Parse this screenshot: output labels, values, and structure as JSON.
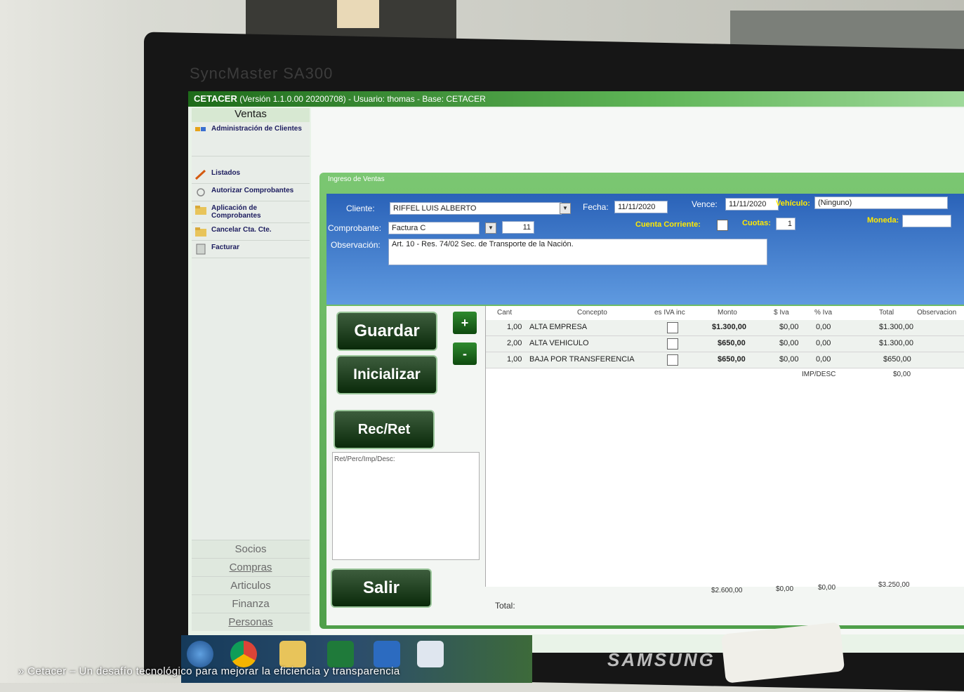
{
  "monitor": {
    "model": "SyncMaster SA300",
    "brand": "SAMSUNG"
  },
  "app": {
    "title_bold": "CETACER",
    "title_rest": "(Versión 1.1.0.00 20200708) - Usuario: thomas - Base: CETACER"
  },
  "sidebar": {
    "header": "Ventas",
    "items": [
      {
        "label": "Administración de Clientes",
        "icon": "clients-icon"
      },
      {
        "label": "Listados",
        "icon": "pencil-icon"
      },
      {
        "label": "Autorizar Comprobantes",
        "icon": "authorize-icon"
      },
      {
        "label": "Aplicación de Comprobantes",
        "icon": "folder-icon"
      },
      {
        "label": "Cancelar Cta. Cte.",
        "icon": "folder-icon"
      },
      {
        "label": "Facturar",
        "icon": "invoice-icon"
      }
    ],
    "bottom": [
      "Socios",
      "Compras",
      "Articulos",
      "Finanza",
      "Personas"
    ]
  },
  "window": {
    "title": "Ingreso de Ventas"
  },
  "form": {
    "cliente_label": "Cliente:",
    "cliente_value": "RIFFEL LUIS ALBERTO",
    "fecha_label": "Fecha:",
    "fecha_value": "11/11/2020",
    "vence_label": "Vence:",
    "vence_value": "11/11/2020",
    "vehiculo_label": "Vehículo:",
    "vehiculo_value": "(Ninguno)",
    "comprobante_label": "Comprobante:",
    "comprobante_value": "Factura C",
    "comprobante_num": "11",
    "cta_cte_label": "Cuenta Corriente:",
    "cuotas_label": "Cuotas:",
    "cuotas_value": "1",
    "moneda_label": "Moneda:",
    "obs_label": "Observación:",
    "obs_value": "Art. 10 - Res. 74/02 Sec. de Transporte de la Nación."
  },
  "buttons": {
    "guardar": "Guardar",
    "inicializar": "Inicializar",
    "recret": "Rec/Ret",
    "salir": "Salir",
    "add": "+",
    "remove": "-"
  },
  "ret_label": "Ret/Perc/Imp/Desc:",
  "table": {
    "headers": [
      "Cant",
      "Concepto",
      "es IVA inc",
      "Monto",
      "$ Iva",
      "% Iva",
      "Total",
      "Observacion"
    ],
    "rows": [
      {
        "cant": "1,00",
        "concepto": "ALTA EMPRESA",
        "monto": "$1.300,00",
        "iva": "$0,00",
        "piva": "0,00",
        "total": "$1.300,00"
      },
      {
        "cant": "2,00",
        "concepto": "ALTA VEHICULO",
        "monto": "$650,00",
        "iva": "$0,00",
        "piva": "0,00",
        "total": "$1.300,00"
      },
      {
        "cant": "1,00",
        "concepto": "BAJA POR TRANSFERENCIA",
        "monto": "$650,00",
        "iva": "$0,00",
        "piva": "0,00",
        "total": "$650,00"
      }
    ],
    "impdesc_label": "IMP/DESC",
    "impdesc_value": "$0,00",
    "totals": {
      "label": "Total:",
      "monto": "$2.600,00",
      "iva": "$0,00",
      "piva": "$0,00",
      "total": "$3.250,00"
    }
  },
  "caption": "» Cetacer – Un desafío tecnológico para mejorar la eficiencia y transparencia"
}
